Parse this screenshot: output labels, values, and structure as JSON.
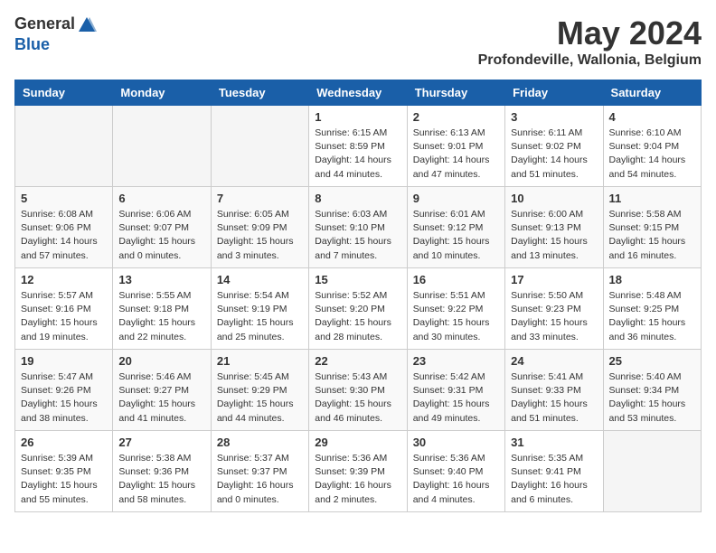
{
  "header": {
    "logo_general": "General",
    "logo_blue": "Blue",
    "title": "May 2024",
    "location": "Profondeville, Wallonia, Belgium"
  },
  "days_of_week": [
    "Sunday",
    "Monday",
    "Tuesday",
    "Wednesday",
    "Thursday",
    "Friday",
    "Saturday"
  ],
  "weeks": [
    [
      {
        "day": "",
        "empty": true
      },
      {
        "day": "",
        "empty": true
      },
      {
        "day": "",
        "empty": true
      },
      {
        "day": "1",
        "sunrise": "6:15 AM",
        "sunset": "8:59 PM",
        "daylight": "14 hours and 44 minutes."
      },
      {
        "day": "2",
        "sunrise": "6:13 AM",
        "sunset": "9:01 PM",
        "daylight": "14 hours and 47 minutes."
      },
      {
        "day": "3",
        "sunrise": "6:11 AM",
        "sunset": "9:02 PM",
        "daylight": "14 hours and 51 minutes."
      },
      {
        "day": "4",
        "sunrise": "6:10 AM",
        "sunset": "9:04 PM",
        "daylight": "14 hours and 54 minutes."
      }
    ],
    [
      {
        "day": "5",
        "sunrise": "6:08 AM",
        "sunset": "9:06 PM",
        "daylight": "14 hours and 57 minutes."
      },
      {
        "day": "6",
        "sunrise": "6:06 AM",
        "sunset": "9:07 PM",
        "daylight": "15 hours and 0 minutes."
      },
      {
        "day": "7",
        "sunrise": "6:05 AM",
        "sunset": "9:09 PM",
        "daylight": "15 hours and 3 minutes."
      },
      {
        "day": "8",
        "sunrise": "6:03 AM",
        "sunset": "9:10 PM",
        "daylight": "15 hours and 7 minutes."
      },
      {
        "day": "9",
        "sunrise": "6:01 AM",
        "sunset": "9:12 PM",
        "daylight": "15 hours and 10 minutes."
      },
      {
        "day": "10",
        "sunrise": "6:00 AM",
        "sunset": "9:13 PM",
        "daylight": "15 hours and 13 minutes."
      },
      {
        "day": "11",
        "sunrise": "5:58 AM",
        "sunset": "9:15 PM",
        "daylight": "15 hours and 16 minutes."
      }
    ],
    [
      {
        "day": "12",
        "sunrise": "5:57 AM",
        "sunset": "9:16 PM",
        "daylight": "15 hours and 19 minutes."
      },
      {
        "day": "13",
        "sunrise": "5:55 AM",
        "sunset": "9:18 PM",
        "daylight": "15 hours and 22 minutes."
      },
      {
        "day": "14",
        "sunrise": "5:54 AM",
        "sunset": "9:19 PM",
        "daylight": "15 hours and 25 minutes."
      },
      {
        "day": "15",
        "sunrise": "5:52 AM",
        "sunset": "9:20 PM",
        "daylight": "15 hours and 28 minutes."
      },
      {
        "day": "16",
        "sunrise": "5:51 AM",
        "sunset": "9:22 PM",
        "daylight": "15 hours and 30 minutes."
      },
      {
        "day": "17",
        "sunrise": "5:50 AM",
        "sunset": "9:23 PM",
        "daylight": "15 hours and 33 minutes."
      },
      {
        "day": "18",
        "sunrise": "5:48 AM",
        "sunset": "9:25 PM",
        "daylight": "15 hours and 36 minutes."
      }
    ],
    [
      {
        "day": "19",
        "sunrise": "5:47 AM",
        "sunset": "9:26 PM",
        "daylight": "15 hours and 38 minutes."
      },
      {
        "day": "20",
        "sunrise": "5:46 AM",
        "sunset": "9:27 PM",
        "daylight": "15 hours and 41 minutes."
      },
      {
        "day": "21",
        "sunrise": "5:45 AM",
        "sunset": "9:29 PM",
        "daylight": "15 hours and 44 minutes."
      },
      {
        "day": "22",
        "sunrise": "5:43 AM",
        "sunset": "9:30 PM",
        "daylight": "15 hours and 46 minutes."
      },
      {
        "day": "23",
        "sunrise": "5:42 AM",
        "sunset": "9:31 PM",
        "daylight": "15 hours and 49 minutes."
      },
      {
        "day": "24",
        "sunrise": "5:41 AM",
        "sunset": "9:33 PM",
        "daylight": "15 hours and 51 minutes."
      },
      {
        "day": "25",
        "sunrise": "5:40 AM",
        "sunset": "9:34 PM",
        "daylight": "15 hours and 53 minutes."
      }
    ],
    [
      {
        "day": "26",
        "sunrise": "5:39 AM",
        "sunset": "9:35 PM",
        "daylight": "15 hours and 55 minutes."
      },
      {
        "day": "27",
        "sunrise": "5:38 AM",
        "sunset": "9:36 PM",
        "daylight": "15 hours and 58 minutes."
      },
      {
        "day": "28",
        "sunrise": "5:37 AM",
        "sunset": "9:37 PM",
        "daylight": "16 hours and 0 minutes."
      },
      {
        "day": "29",
        "sunrise": "5:36 AM",
        "sunset": "9:39 PM",
        "daylight": "16 hours and 2 minutes."
      },
      {
        "day": "30",
        "sunrise": "5:36 AM",
        "sunset": "9:40 PM",
        "daylight": "16 hours and 4 minutes."
      },
      {
        "day": "31",
        "sunrise": "5:35 AM",
        "sunset": "9:41 PM",
        "daylight": "16 hours and 6 minutes."
      },
      {
        "day": "",
        "empty": true
      }
    ]
  ]
}
